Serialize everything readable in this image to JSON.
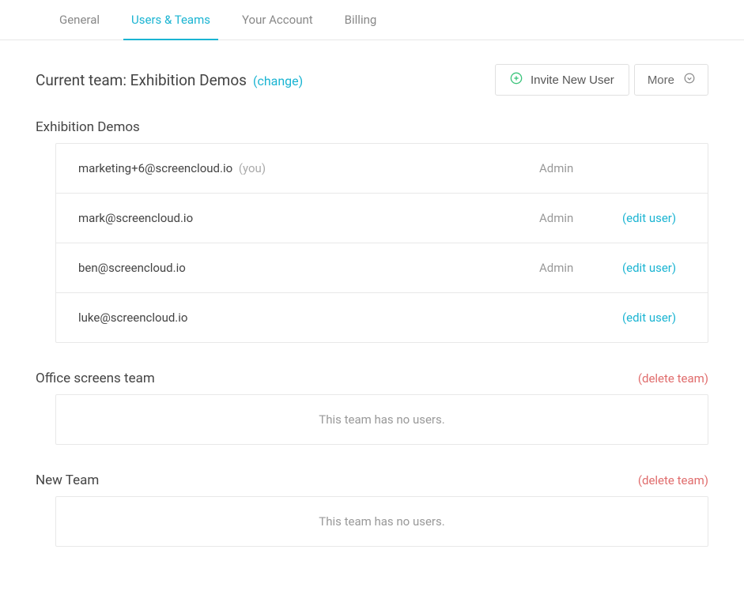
{
  "tabs": {
    "general": "General",
    "users_teams": "Users & Teams",
    "your_account": "Your Account",
    "billing": "Billing"
  },
  "header": {
    "current_team_prefix": "Current team: ",
    "current_team_name": "Exhibition Demos",
    "change_label": "(change)",
    "invite_label": "Invite New User",
    "more_label": "More"
  },
  "teams": [
    {
      "name": "Exhibition Demos",
      "deletable": false,
      "users": [
        {
          "email": "marketing+6@screencloud.io",
          "role": "Admin",
          "is_you": true,
          "editable": false
        },
        {
          "email": "mark@screencloud.io",
          "role": "Admin",
          "is_you": false,
          "editable": true
        },
        {
          "email": "ben@screencloud.io",
          "role": "Admin",
          "is_you": false,
          "editable": true
        },
        {
          "email": "luke@screencloud.io",
          "role": "",
          "is_you": false,
          "editable": true
        }
      ]
    },
    {
      "name": "Office screens team",
      "deletable": true,
      "users": []
    },
    {
      "name": "New Team",
      "deletable": true,
      "users": []
    }
  ],
  "labels": {
    "you": "(you)",
    "edit_user": "(edit user)",
    "delete_team": "(delete team)",
    "no_users": "This team has no users."
  }
}
